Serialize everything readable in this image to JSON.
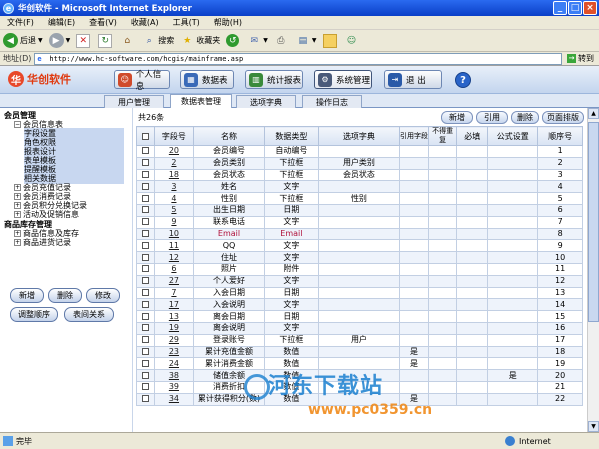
{
  "window": {
    "title": "华创软件 - Microsoft Internet Explorer"
  },
  "menubar": {
    "items": [
      "文件(F)",
      "编辑(E)",
      "查看(V)",
      "收藏(A)",
      "工具(T)",
      "帮助(H)"
    ]
  },
  "toolbar": {
    "back": "后退",
    "search": "搜索",
    "favorites": "收藏夹"
  },
  "address": {
    "label": "地址(D)",
    "url": "http://www.hc-software.com/hcgis/mainframe.asp",
    "go": "转到"
  },
  "app": {
    "logo": "华创软件",
    "nav": [
      "个人信息",
      "数据表",
      "统计报表",
      "系统管理",
      "退 出"
    ],
    "help": "?"
  },
  "tabs": [
    "用户管理",
    "数据表管理",
    "选项字典",
    "操作日志"
  ],
  "sidebar": {
    "group1": "会员管理",
    "member_info": "会员信息表",
    "sub": [
      "字段设置",
      "角色权限",
      "报表设计",
      "表单模板",
      "提醒模板",
      "相关数据"
    ],
    "more": [
      "会员充值记录",
      "会员消费记录",
      "会员积分兑换记录",
      "活动及促销信息"
    ],
    "group2": "商品库存管理",
    "goods": [
      "商品信息及库存",
      "商品进货记录"
    ],
    "buttons": [
      "新增",
      "删除",
      "修改",
      "调整顺序",
      "表间关系"
    ]
  },
  "main": {
    "count": "共26条",
    "actions": [
      "新增",
      "引用",
      "删除",
      "页面排版"
    ],
    "columns": [
      "字段号",
      "名称",
      "数据类型",
      "选项字典",
      "引用字段",
      "不得重复",
      "必填",
      "公式设置",
      "顺序号"
    ],
    "rows": [
      {
        "id": "20",
        "name": "会员编号",
        "type": "自动编号",
        "dict": "",
        "ref": "",
        "uniq": "",
        "req": "",
        "formula": "",
        "order": "1",
        "red": false
      },
      {
        "id": "2",
        "name": "会员类别",
        "type": "下拉框",
        "dict": "用户类别",
        "ref": "",
        "uniq": "",
        "req": "",
        "formula": "",
        "order": "2",
        "red": false
      },
      {
        "id": "18",
        "name": "会员状态",
        "type": "下拉框",
        "dict": "会员状态",
        "ref": "",
        "uniq": "",
        "req": "",
        "formula": "",
        "order": "3",
        "red": false
      },
      {
        "id": "3",
        "name": "姓名",
        "type": "文字",
        "dict": "",
        "ref": "",
        "uniq": "",
        "req": "",
        "formula": "",
        "order": "4",
        "red": false
      },
      {
        "id": "4",
        "name": "性别",
        "type": "下拉框",
        "dict": "性别",
        "ref": "",
        "uniq": "",
        "req": "",
        "formula": "",
        "order": "5",
        "red": false
      },
      {
        "id": "5",
        "name": "出生日期",
        "type": "日期",
        "dict": "",
        "ref": "",
        "uniq": "",
        "req": "",
        "formula": "",
        "order": "6",
        "red": false
      },
      {
        "id": "9",
        "name": "联系电话",
        "type": "文字",
        "dict": "",
        "ref": "",
        "uniq": "",
        "req": "",
        "formula": "",
        "order": "7",
        "red": false
      },
      {
        "id": "10",
        "name": "Email",
        "type": "Email",
        "dict": "",
        "ref": "",
        "uniq": "",
        "req": "",
        "formula": "",
        "order": "8",
        "red": true
      },
      {
        "id": "11",
        "name": "QQ",
        "type": "文字",
        "dict": "",
        "ref": "",
        "uniq": "",
        "req": "",
        "formula": "",
        "order": "9",
        "red": false
      },
      {
        "id": "12",
        "name": "住址",
        "type": "文字",
        "dict": "",
        "ref": "",
        "uniq": "",
        "req": "",
        "formula": "",
        "order": "10",
        "red": false
      },
      {
        "id": "6",
        "name": "照片",
        "type": "附件",
        "dict": "",
        "ref": "",
        "uniq": "",
        "req": "",
        "formula": "",
        "order": "11",
        "red": false
      },
      {
        "id": "27",
        "name": "个人爱好",
        "type": "文字",
        "dict": "",
        "ref": "",
        "uniq": "",
        "req": "",
        "formula": "",
        "order": "12",
        "red": false
      },
      {
        "id": "7",
        "name": "入会日期",
        "type": "日期",
        "dict": "",
        "ref": "",
        "uniq": "",
        "req": "",
        "formula": "",
        "order": "13",
        "red": false
      },
      {
        "id": "17",
        "name": "入会说明",
        "type": "文字",
        "dict": "",
        "ref": "",
        "uniq": "",
        "req": "",
        "formula": "",
        "order": "14",
        "red": false
      },
      {
        "id": "13",
        "name": "离会日期",
        "type": "日期",
        "dict": "",
        "ref": "",
        "uniq": "",
        "req": "",
        "formula": "",
        "order": "15",
        "red": false
      },
      {
        "id": "19",
        "name": "离会说明",
        "type": "文字",
        "dict": "",
        "ref": "",
        "uniq": "",
        "req": "",
        "formula": "",
        "order": "16",
        "red": false
      },
      {
        "id": "29",
        "name": "登录账号",
        "type": "下拉框",
        "dict": "用户",
        "ref": "",
        "uniq": "",
        "req": "",
        "formula": "",
        "order": "17",
        "red": false
      },
      {
        "id": "23",
        "name": "累计充值金额",
        "type": "数值",
        "dict": "",
        "ref": "是",
        "uniq": "",
        "req": "",
        "formula": "",
        "order": "18",
        "red": false
      },
      {
        "id": "24",
        "name": "累计消费金额",
        "type": "数值",
        "dict": "",
        "ref": "是",
        "uniq": "",
        "req": "",
        "formula": "",
        "order": "19",
        "red": false
      },
      {
        "id": "38",
        "name": "储值余额",
        "type": "数值",
        "dict": "",
        "ref": "",
        "uniq": "",
        "req": "",
        "formula": "是",
        "order": "20",
        "red": false
      },
      {
        "id": "39",
        "name": "消费折扣",
        "type": "数值",
        "dict": "",
        "ref": "",
        "uniq": "",
        "req": "",
        "formula": "",
        "order": "21",
        "red": false
      },
      {
        "id": "34",
        "name": "累计获得积分(数)",
        "type": "数值",
        "dict": "",
        "ref": "是",
        "uniq": "",
        "req": "",
        "formula": "",
        "order": "22",
        "red": false
      }
    ]
  },
  "status": {
    "done": "完毕",
    "zone": "Internet"
  },
  "watermark": {
    "main": "河东下载站",
    "sub": "www.pc0359.cn"
  }
}
